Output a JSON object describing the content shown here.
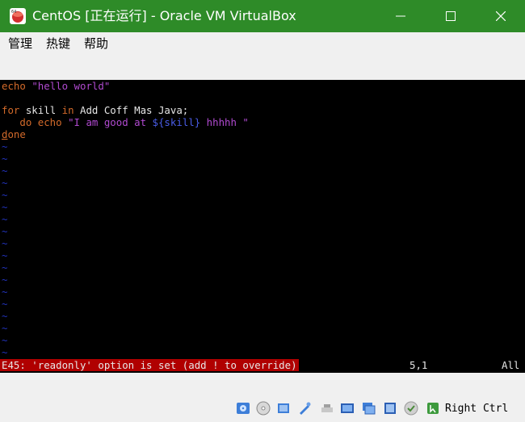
{
  "window": {
    "title": "CentOS [正在运行] - Oracle VM VirtualBox",
    "title_color": "#2e8b28"
  },
  "menu": [
    {
      "label": "管理"
    },
    {
      "label": "热键"
    },
    {
      "label": "帮助"
    }
  ],
  "editor": {
    "lines": [
      {
        "segments": [
          {
            "text": "echo ",
            "kind": "keyword"
          },
          {
            "text": "\"hello world\"",
            "kind": "string"
          }
        ]
      },
      {
        "segments": []
      },
      {
        "segments": [
          {
            "text": "for",
            "kind": "keyword"
          },
          {
            "text": " skill ",
            "kind": "plain"
          },
          {
            "text": "in",
            "kind": "keyword"
          },
          {
            "text": " Add Coff Mas Java;",
            "kind": "plain"
          }
        ]
      },
      {
        "segments": [
          {
            "text": "   do ",
            "kind": "keyword"
          },
          {
            "text": "echo",
            "kind": "keyword"
          },
          {
            "text": " \"I am good at ",
            "kind": "string"
          },
          {
            "text": "${skill}",
            "kind": "variable"
          },
          {
            "text": " hhhhh \"",
            "kind": "string"
          }
        ]
      },
      {
        "segments": [
          {
            "text": "done",
            "kind": "keyword"
          }
        ]
      }
    ],
    "empty_line_marker": "~",
    "status_error": "E45: 'readonly' option is set (add ! to override)",
    "cursor_position": "5,1",
    "scroll_position": "All",
    "colors": {
      "keyword": "#d36a2a",
      "string": "#b04ad0",
      "variable": "#4a5de8",
      "plain": "#e6e6e6",
      "tilde": "#2233bb",
      "error_bg": "#b00000"
    }
  },
  "statusbar": {
    "icons": [
      "hard-disk-icon",
      "optical-drive-icon",
      "audio-icon",
      "network-icon",
      "usb-icon",
      "shared-folders-icon",
      "display-icon",
      "video-capture-icon",
      "cpu-icon",
      "mouse-integration-icon",
      "keyboard-capture-icon"
    ],
    "host_key": "Right Ctrl"
  }
}
